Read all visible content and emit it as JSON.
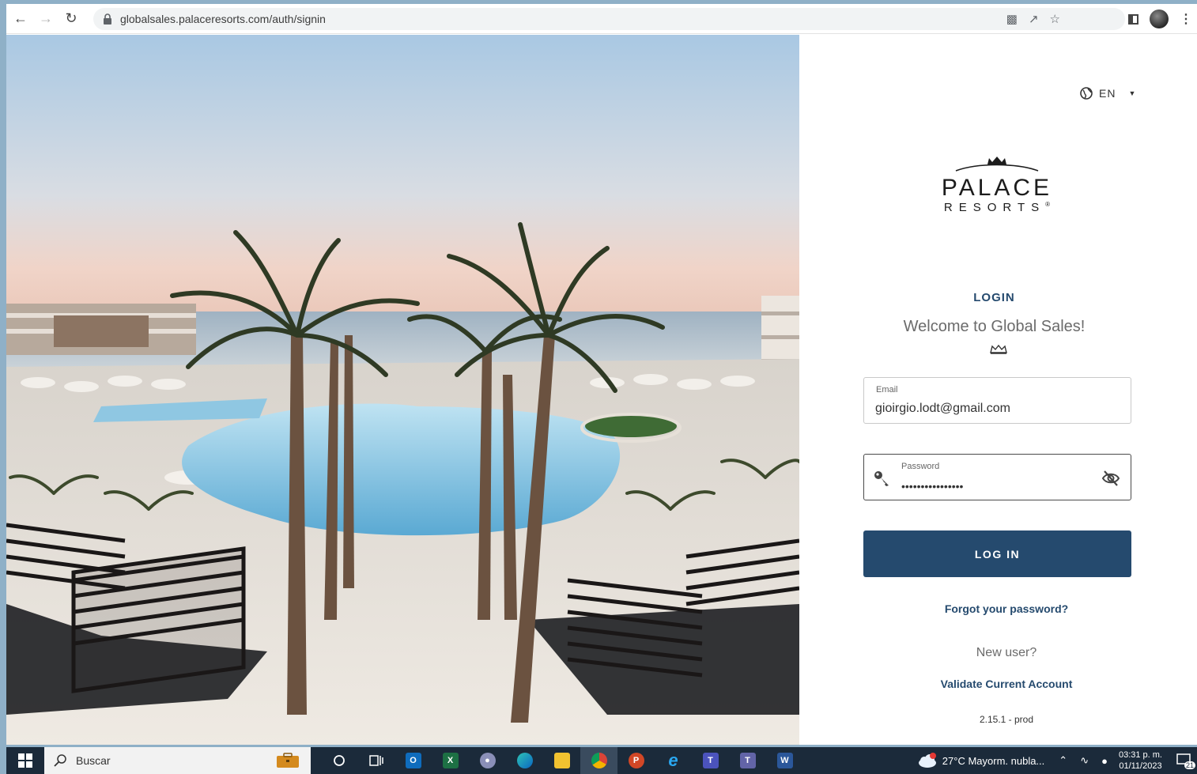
{
  "browser": {
    "url": "globalsales.palaceresorts.com/auth/signin",
    "icons": [
      "back-arrow-icon",
      "forward-arrow-icon",
      "reload-icon",
      "lock-icon",
      "translate-icon",
      "share-icon",
      "star-icon",
      "side-panel-icon",
      "profile-avatar",
      "menu-dots-icon"
    ]
  },
  "login": {
    "language": "EN",
    "logo_line1": "PALACE",
    "logo_line2": "RESORTS",
    "logo_mark": "®",
    "title": "LOGIN",
    "welcome": "Welcome to Global Sales!",
    "email_label": "Email",
    "email_value": "gioirgio.lodt@gmail.com",
    "password_label": "Password",
    "password_value": "••••••••••••••••",
    "login_button": "LOG IN",
    "forgot_link": "Forgot your password?",
    "new_user": "New user?",
    "validate_link": "Validate Current Account",
    "version": "2.15.1 - prod"
  },
  "taskbar": {
    "search_placeholder": "Buscar",
    "weather": "27°C  Mayorm. nubla...",
    "time": "03:31 p. m.",
    "date": "01/11/2023",
    "notifications": "21",
    "apps": [
      "cortana-icon",
      "task-view-icon",
      "outlook-icon",
      "excel-icon",
      "paint-icon",
      "edge-icon",
      "file-explorer-icon",
      "chrome-icon",
      "powerpoint-icon",
      "ie-icon",
      "teams-icon",
      "teams-badge-icon",
      "word-icon"
    ]
  },
  "colors": {
    "brand_navy": "#254a6e",
    "taskbar_bg": "#1b2a3a",
    "desktop_bg": "#8fb0c7"
  }
}
